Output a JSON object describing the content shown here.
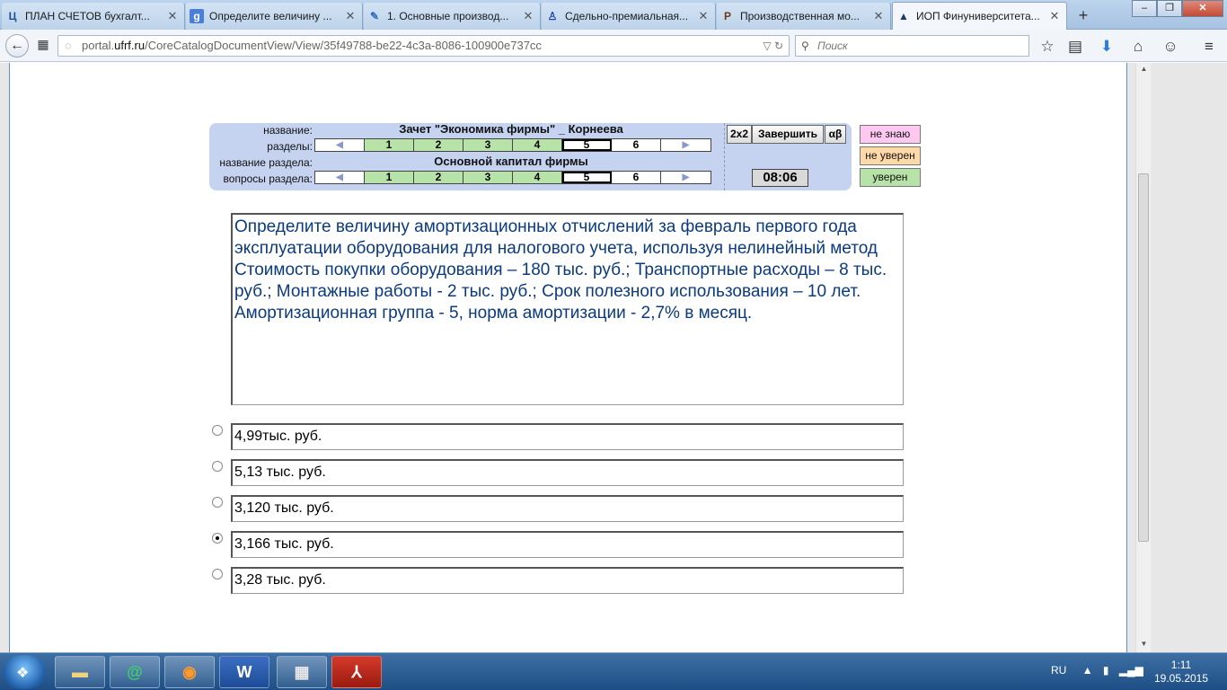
{
  "browser": {
    "tabs": [
      {
        "favicon": "Ц",
        "title": "ПЛАН СЧЕТОВ бухгалт...",
        "active": false
      },
      {
        "favicon": "g",
        "title": "Определите величину ...",
        "active": false
      },
      {
        "favicon": "✎",
        "title": "1. Основные производ...",
        "active": false
      },
      {
        "favicon": "♙",
        "title": "Сдельно-премиальная...",
        "active": false
      },
      {
        "favicon": "P",
        "title": "Производственная мо...",
        "active": false
      },
      {
        "favicon": "▲",
        "title": "ИОП Финуниверситета...",
        "active": true
      }
    ],
    "new_tab": "+",
    "url_prefix": "portal.",
    "url_domain": "ufrf.ru",
    "url_path": "/CoreCatalogDocumentView/View/35f49788-be22-4c3a-8086-100900e737cc",
    "search_placeholder": "Поиск"
  },
  "quiz": {
    "labels": {
      "name": "название:",
      "sections": "разделы:",
      "section_name": "название раздела:",
      "section_questions": "вопросы раздела:"
    },
    "title": "Зачет \"Экономика фирмы\" _ Корнеева",
    "section_title": "Основной капитал фирмы",
    "sections": [
      "1",
      "2",
      "3",
      "4",
      "5",
      "6"
    ],
    "questions": [
      "1",
      "2",
      "3",
      "4",
      "5",
      "6"
    ],
    "buttons": {
      "grid": "2x2",
      "finish": "Завершить",
      "alpha": "αβ"
    },
    "timer": "08:06",
    "confidence": {
      "dont_know": "не знаю",
      "not_sure": "не уверен",
      "sure": "уверен"
    },
    "confidence_colors": {
      "dont_know": "#ffc8f0",
      "not_sure": "#ffd9a8",
      "sure": "#b8e3a8"
    },
    "question_text": "Определите величину амортизационных отчислений за февраль первого года эксплуатации оборудования для налогового учета, используя нелинейный метод Стоимость покупки оборудования – 180 тыс. руб.; Транспортные расходы – 8 тыс. руб.;  Монтажные работы - 2 тыс. руб.; Срок полезного использования – 10 лет. Амортизационная группа - 5, норма амортизации - 2,7% в месяц.",
    "answers": [
      "4,99тыс. руб.",
      "5,13 тыс. руб.",
      "3,120 тыс. руб.",
      "3,166 тыс. руб.",
      "3,28 тыс. руб."
    ],
    "selected_answer": "3,166 тыс. руб."
  },
  "taskbar": {
    "language": "RU",
    "time": "1:11",
    "date": "19.05.2015"
  }
}
